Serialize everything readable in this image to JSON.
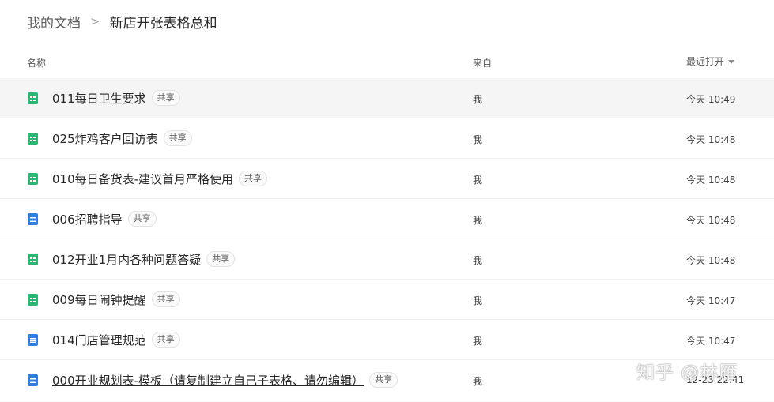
{
  "breadcrumb": {
    "root": "我的文档",
    "separator": ">",
    "current": "新店开张表格总和"
  },
  "columns": {
    "name": "名称",
    "from": "来自",
    "opened": "最近打开"
  },
  "files": [
    {
      "type": "sheet",
      "name": "011每日卫生要求",
      "badge": "共享",
      "from": "我",
      "opened": "今天 10:49"
    },
    {
      "type": "sheet",
      "name": "025炸鸡客户回访表",
      "badge": "共享",
      "from": "我",
      "opened": "今天 10:48"
    },
    {
      "type": "sheet",
      "name": "010每日备货表-建议首月严格使用",
      "badge": "共享",
      "from": "我",
      "opened": "今天 10:48"
    },
    {
      "type": "doc",
      "name": "006招聘指导",
      "badge": "共享",
      "from": "我",
      "opened": "今天 10:48"
    },
    {
      "type": "sheet",
      "name": "012开业1月内各种问题答疑",
      "badge": "共享",
      "from": "我",
      "opened": "今天 10:48"
    },
    {
      "type": "sheet",
      "name": "009每日闹钟提醒",
      "badge": "共享",
      "from": "我",
      "opened": "今天 10:47"
    },
    {
      "type": "doc",
      "name": "014门店管理规范",
      "badge": "共享",
      "from": "我",
      "opened": "今天 10:47"
    },
    {
      "type": "doc",
      "name": "000开业规划表-模板（请复制建立自己子表格、请勿编辑）",
      "badge": "共享",
      "from": "我",
      "opened": "12-23 22:41"
    }
  ],
  "icons": {
    "sheet": "spreadsheet-icon",
    "doc": "document-icon",
    "sort": "sort-down-icon"
  },
  "colors": {
    "sheet_icon": "#2bb673",
    "doc_icon": "#2e7fe0",
    "active_row": "#f5f5f5"
  },
  "watermark": "知乎 @林雁"
}
